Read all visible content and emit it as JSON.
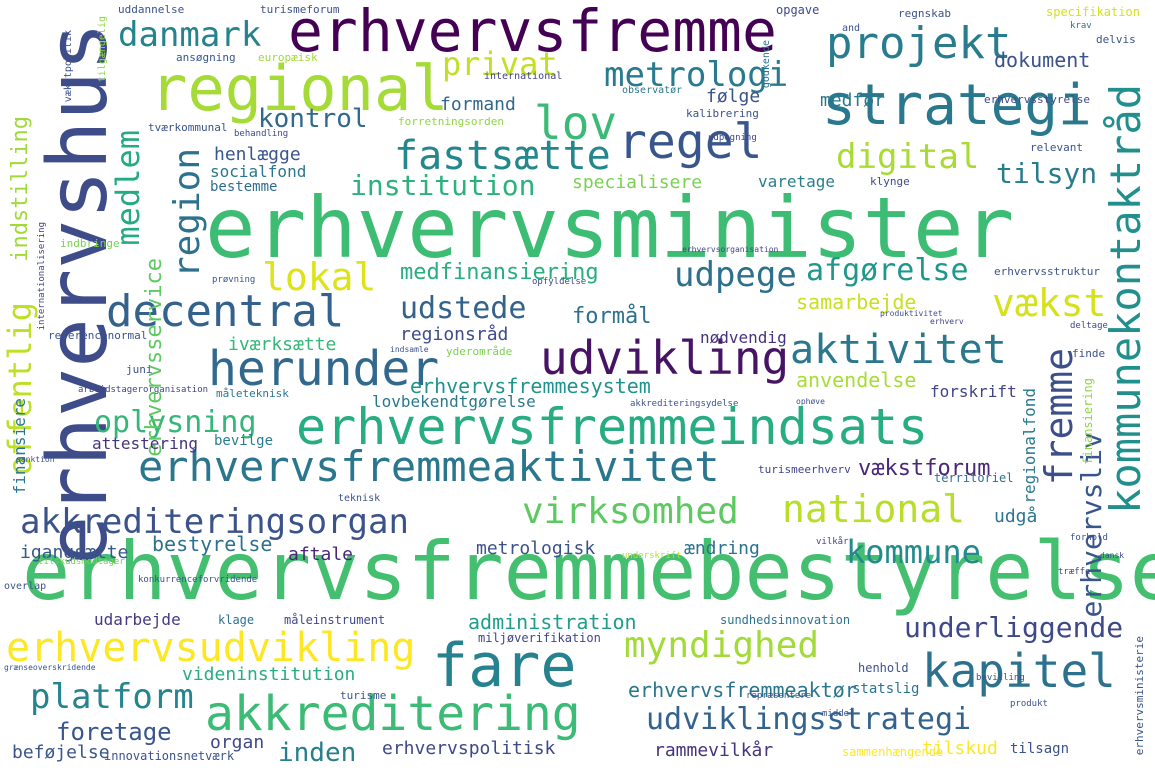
{
  "words": {
    "erhvervsminister": "erhvervsminister",
    "erhvervsfremmebestyrelse": "erhvervsfremmebestyrelse",
    "erhvervshus": "erhvervshus",
    "erhvervsfremme": "erhvervsfremme",
    "regional": "regional",
    "strategi": "strategi",
    "erhvervsfremmeindsats": "erhvervsfremmeindsats",
    "erhvervsfremmeaktivitet": "erhvervsfremmeaktivitet",
    "akkreditering": "akkreditering",
    "fare": "fare",
    "kommunekontaktråd": "kommunekontaktråd",
    "regel": "regel",
    "herunder": "herunder",
    "decentral": "decentral",
    "udvikling": "udvikling",
    "akkrediteringsorgan": "akkrediteringsorgan",
    "kapitel": "kapitel",
    "projekt": "projekt",
    "lov": "lov",
    "metrologi": "metrologi",
    "danmark": "danmark",
    "fastsætte": "fastsætte",
    "aktivitet": "aktivitet",
    "virksomhed": "virksomhed",
    "national": "national",
    "erhvervsudvikling": "erhvervsudvikling",
    "myndighed": "myndighed",
    "platform": "platform",
    "udviklingsstrategi": "udviklingsstrategi",
    "fremme": "fremme",
    "vækst": "vækst",
    "lokal": "lokal",
    "udpege": "udpege",
    "region": "region",
    "offentlig": "offentlig",
    "medlem": "medlem",
    "privat": "privat",
    "digital": "digital",
    "institution": "institution",
    "afgørelse": "afgørelse",
    "udstede": "udstede",
    "kommune": "kommune",
    "underliggende": "underliggende",
    "oplysning": "oplysning",
    "tilsyn": "tilsyn",
    "kontrol": "kontrol",
    "erhvervsliv": "erhvervsliv",
    "erhvervsservice": "erhvervsservice",
    "indstilling": "indstilling",
    "medfinansiering": "medfinansiering",
    "erhvervsfremmesystem": "erhvervsfremmesystem",
    "erhvervsfremmeaktør": "erhvervsfremmeaktør",
    "foretage": "foretage",
    "inden": "inden",
    "formål": "formål",
    "samarbejde": "samarbejde",
    "anvendelse": "anvendelse",
    "vækstforum": "vækstforum",
    "regionalfond": "regionalfond",
    "bestyrelse": "bestyrelse",
    "administration": "administration",
    "videninstitution": "videninstitution",
    "erhvervspolitisk": "erhvervspolitisk",
    "rammevilkår": "rammevilkår",
    "tilskud": "tilskud",
    "dokument": "dokument",
    "specialisere": "specialisere",
    "henlægge": "henlægge",
    "socialfond": "socialfond",
    "bestemme": "bestemme",
    "varetage": "varetage",
    "formand": "formand",
    "følge": "følge",
    "medfør": "medfør",
    "iværksætte": "iværksætte",
    "regionsråd": "regionsråd",
    "nødvendig": "nødvendig",
    "forskrift": "forskrift",
    "lovbekendtgørelse": "lovbekendtgørelse",
    "metrologisk": "metrologisk",
    "ændring": "ændring",
    "aftale": "aftale",
    "igangsætte": "igangsætte",
    "udarbejde": "udarbejde",
    "udgå": "udgå",
    "attestering": "attestering",
    "bevilge": "bevilge",
    "finansiere": "finansiere",
    "organ": "organ",
    "beføjelse": "beføjelse",
    "klage": "klage",
    "måleinstrument": "måleinstrument",
    "miljøverifikation": "miljøverifikation",
    "sundhedsinnovation": "sundhedsinnovation",
    "henhold": "henhold",
    "statslig": "statslig",
    "tilsagn": "tilsagn",
    "sammenhængende": "sammenhængende",
    "innovationsnetværk": "innovationsnetværk",
    "turisme": "turisme",
    "turismeerhverv": "turismeerhverv",
    "territoriel": "territoriel",
    "finansiering": "finansiering",
    "uddannelse": "uddannelse",
    "turismeforum": "turismeforum",
    "opgave": "opgave",
    "regnskab": "regnskab",
    "specifikation": "specifikation",
    "krav": "krav",
    "delvis": "delvis",
    "and": "and",
    "ansøgning": "ansøgning",
    "europæisk": "europæisk",
    "international": "international",
    "observatør": "observatør",
    "erhvervsstyrelse": "erhvervsstyrelse",
    "kalibrering": "kalibrering",
    "forretningsorden": "forretningsorden",
    "behandling": "behandling",
    "tværkommunal": "tværkommunal",
    "relevant": "relevant",
    "klynge": "klynge",
    "udpegning": "udpegning",
    "tilgængelig": "tilgængelig",
    "vækstpolitik": "vækstpolitik",
    "godkende": "godkende",
    "internationalisering": "internationalisering",
    "indbringe": "indbringe",
    "prøvning": "prøvning",
    "erhvervsorganisation": "erhvervsorganisation",
    "erhvervsstruktur": "erhvervsstruktur",
    "referencenormal": "referencenormal",
    "yderområde": "yderområde",
    "produktivitet": "produktivitet",
    "erhverv": "erhverv",
    "deltage": "deltage",
    "juni": "juni",
    "finde": "finde",
    "arbejdstagerorganisation": "arbejdstagerorganisation",
    "måleteknisk": "måleteknisk",
    "akkrediteringsydelse": "akkrediteringsydelse",
    "ophøve": "ophøve",
    "sanktion": "sanktion",
    "teknisk": "teknisk",
    "opfyldelse": "opfyldelse",
    "tilskudsmodtager": "tilskudsmodtager",
    "konkurrenceforvridende": "konkurrenceforvridende",
    "overlap": "overlap",
    "underskrift": "underskrift",
    "vilkår": "vilkår",
    "forhold": "forhold",
    "træffe": "træffe",
    "dansk": "dansk",
    "grænseoverskridende": "grænseoverskridende",
    "bevilling": "bevilling",
    "repræsentere": "repræsentere",
    "middel": "middel",
    "produkt": "produkt",
    "erhvervsministerie": "erhvervsministerie",
    "indsamle": "indsamle"
  }
}
